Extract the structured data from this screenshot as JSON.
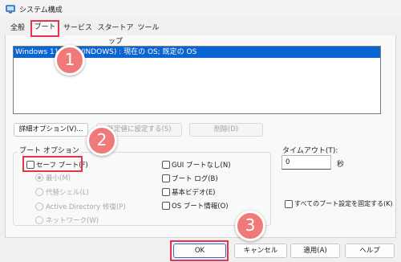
{
  "window": {
    "title": "システム構成"
  },
  "tabs": [
    {
      "label": "全般"
    },
    {
      "label": "ブート"
    },
    {
      "label": "サービス"
    },
    {
      "label": "スタートアップ"
    },
    {
      "label": "ツール"
    }
  ],
  "boot_list": {
    "selected_entry": "Windows 11 (C:¥WINDOWS) : 現在の OS; 既定の OS"
  },
  "list_buttons": {
    "advanced": "詳細オプション(V)...",
    "set_default": "既定値に設定する(S)",
    "delete": "削除(D)"
  },
  "boot_options": {
    "group_label": "ブート オプション",
    "safe_boot": "セーフ ブート(F)",
    "radios": [
      {
        "label": "最小(M)",
        "checked": true
      },
      {
        "label": "代替シェル(L)",
        "checked": false
      },
      {
        "label": "Active Directory 修復(P)",
        "checked": false
      },
      {
        "label": "ネットワーク(W)",
        "checked": false
      }
    ],
    "checks": [
      {
        "label": "GUI ブートなし(N)"
      },
      {
        "label": "ブート ログ(B)"
      },
      {
        "label": "基本ビデオ(E)"
      },
      {
        "label": "OS ブート情報(O)"
      }
    ]
  },
  "timeout": {
    "label": "タイムアウト(T):",
    "value": "0",
    "unit": "秒"
  },
  "make_permanent": "すべてのブート設定を固定する(K)",
  "footer_buttons": {
    "ok": "OK",
    "cancel": "キャンセル",
    "apply": "適用(A)",
    "help": "ヘルプ"
  },
  "callouts": [
    "1",
    "2",
    "3"
  ],
  "colors": {
    "selection": "#0a64d2",
    "callout_border": "#e9334a",
    "callout_fill": "#f07a7a"
  }
}
